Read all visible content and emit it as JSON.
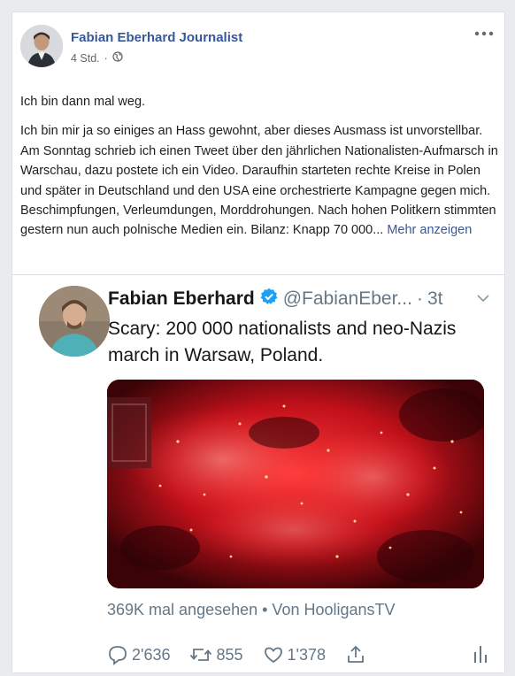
{
  "post": {
    "author": "Fabian Eberhard Journalist",
    "time": "4 Std.",
    "separator": "·",
    "intro": "Ich bin dann mal weg.",
    "body": "Ich bin mir ja so einiges an Hass gewohnt, aber dieses Ausmass ist unvorstellbar. Am Sonntag schrieb ich einen Tweet über den jährlichen Nationalisten-Aufmarsch in Warschau, dazu postete ich ein Video. Daraufhin starteten rechte Kreise in Polen und später in Deutschland und den USA eine orchestrierte Kampagne gegen mich. Beschimpfungen, Verleumdungen, Morddrohungen. Nach hohen Politkern stimmten gestern nun auch polnische Medien ein. Bilanz: Knapp 70 000...",
    "see_more": "Mehr anzeigen",
    "icons": {
      "privacy": "globe-icon",
      "menu": "more-options-icon"
    }
  },
  "tweet": {
    "name": "Fabian Eberhard",
    "handle": "@FabianEber...",
    "dot": "·",
    "time": "3t",
    "text": "Scary: 200 000 nationalists and neo-Nazis march in Warsaw, Poland.",
    "views": "369K mal angesehen • Von HooligansTV",
    "replies": "2'636",
    "retweets": "855",
    "likes": "1'378",
    "colors": {
      "verified": "#1da1f2",
      "muted": "#657786",
      "media_glow": "#ff2a2a"
    }
  }
}
